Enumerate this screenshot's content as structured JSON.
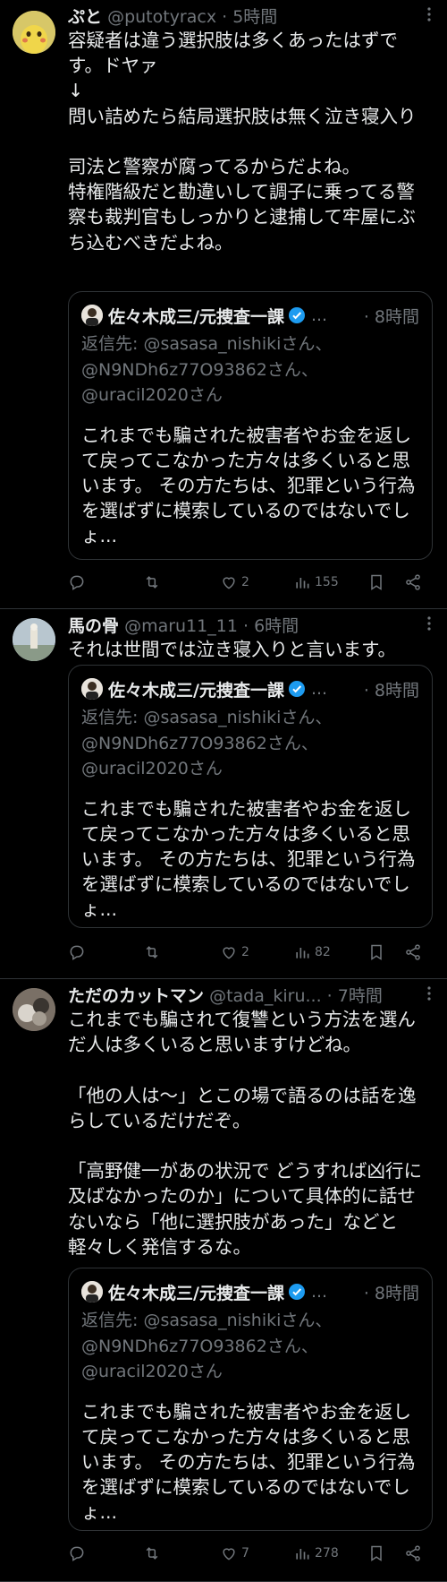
{
  "tweets": [
    {
      "name": "ぷと",
      "handle": "@putotyracx",
      "dot": "·",
      "time": "5時間",
      "text": "容疑者は違う選択肢は多くあったはずです。ドヤァ\n↓\n問い詰めたら結局選択肢は無く泣き寝入り\n\n司法と警察が腐ってるからだよね。\n特権階級だと勘違いして調子に乗ってる警察も裁判官もしっかりと逮捕して牢屋にぶち込むべきだよね。",
      "stats": {
        "reply": "",
        "retweet": "",
        "like": "2",
        "views": "155"
      }
    },
    {
      "name": "馬の骨",
      "handle": "@maru11_11",
      "dot": "·",
      "time": "6時間",
      "text": "それは世間では泣き寝入りと言います。",
      "stats": {
        "reply": "",
        "retweet": "",
        "like": "2",
        "views": "82"
      }
    },
    {
      "name": "ただのカットマン",
      "handle": "@tada_kiru...",
      "dot": "·",
      "time": "7時間",
      "text": "これまでも騙されて復讐という方法を選んだ人は多くいると思いますけどね。\n\n「他の人は〜」とこの場で語るのは話を逸らしているだけだぞ。\n\n「高野健一があの状況で どうすれば凶行に及ばなかったのか」について具体的に話せないなら「他に選択肢があった」などと軽々しく発信するな。",
      "stats": {
        "reply": "",
        "retweet": "",
        "like": "7",
        "views": "278"
      }
    }
  ],
  "quote": {
    "name": "佐々木成三/元捜査一課",
    "truncation": "...",
    "time": "· 8時間",
    "reply_to": "返信先: @sasasa_nishikiさん、@N9NDh6z77O93862さん、@uracil2020さん",
    "text": "これまでも騙された被害者やお金を返して戻ってこなかった方々は多くいると思います。\nその方たちは、犯罪という行為を選ばずに模索しているのではないでしょ..."
  },
  "icons": {
    "more": "more-dots-icon",
    "reply": "reply-icon",
    "retweet": "retweet-icon",
    "like": "heart-icon",
    "views": "views-bar-chart-icon",
    "bookmark": "bookmark-icon",
    "share": "share-icon",
    "verified": "verified-badge-icon"
  },
  "colors": {
    "background": "#000000",
    "text": "#e7e9ea",
    "muted": "#71767b",
    "border": "#2f3336",
    "verified": "#1d9bf0"
  }
}
